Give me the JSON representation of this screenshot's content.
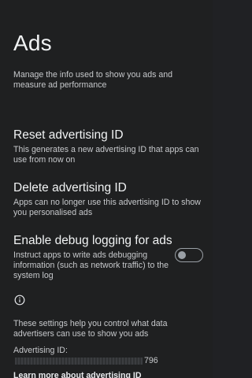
{
  "page": {
    "title": "Ads"
  },
  "intro": {
    "text": "Manage the info used to show you ads and measure ad performance"
  },
  "settings": [
    {
      "title": "Reset advertising ID",
      "description": "This generates a new advertising ID that apps can use from now on"
    },
    {
      "title": "Delete advertising ID",
      "description": "Apps can no longer use this advertising ID to show you personalised ads"
    },
    {
      "title": "Enable debug logging for ads",
      "description": "Instruct apps to write ads debugging information (such as network traffic) to the system log",
      "toggle_on": false
    }
  ],
  "footer": {
    "info_icon": "info-icon",
    "text": "These settings help you control what data advertisers can use to show you ads",
    "advertising_id_label": "Advertising ID:",
    "advertising_id_visible_suffix": "796",
    "learn_more_link": "Learn more about advertising ID"
  },
  "colors": {
    "background": "#1f2021",
    "primary_text": "#f1f3f4",
    "secondary_text": "#c7c9cc",
    "toggle_off": "#9aa0a6"
  }
}
